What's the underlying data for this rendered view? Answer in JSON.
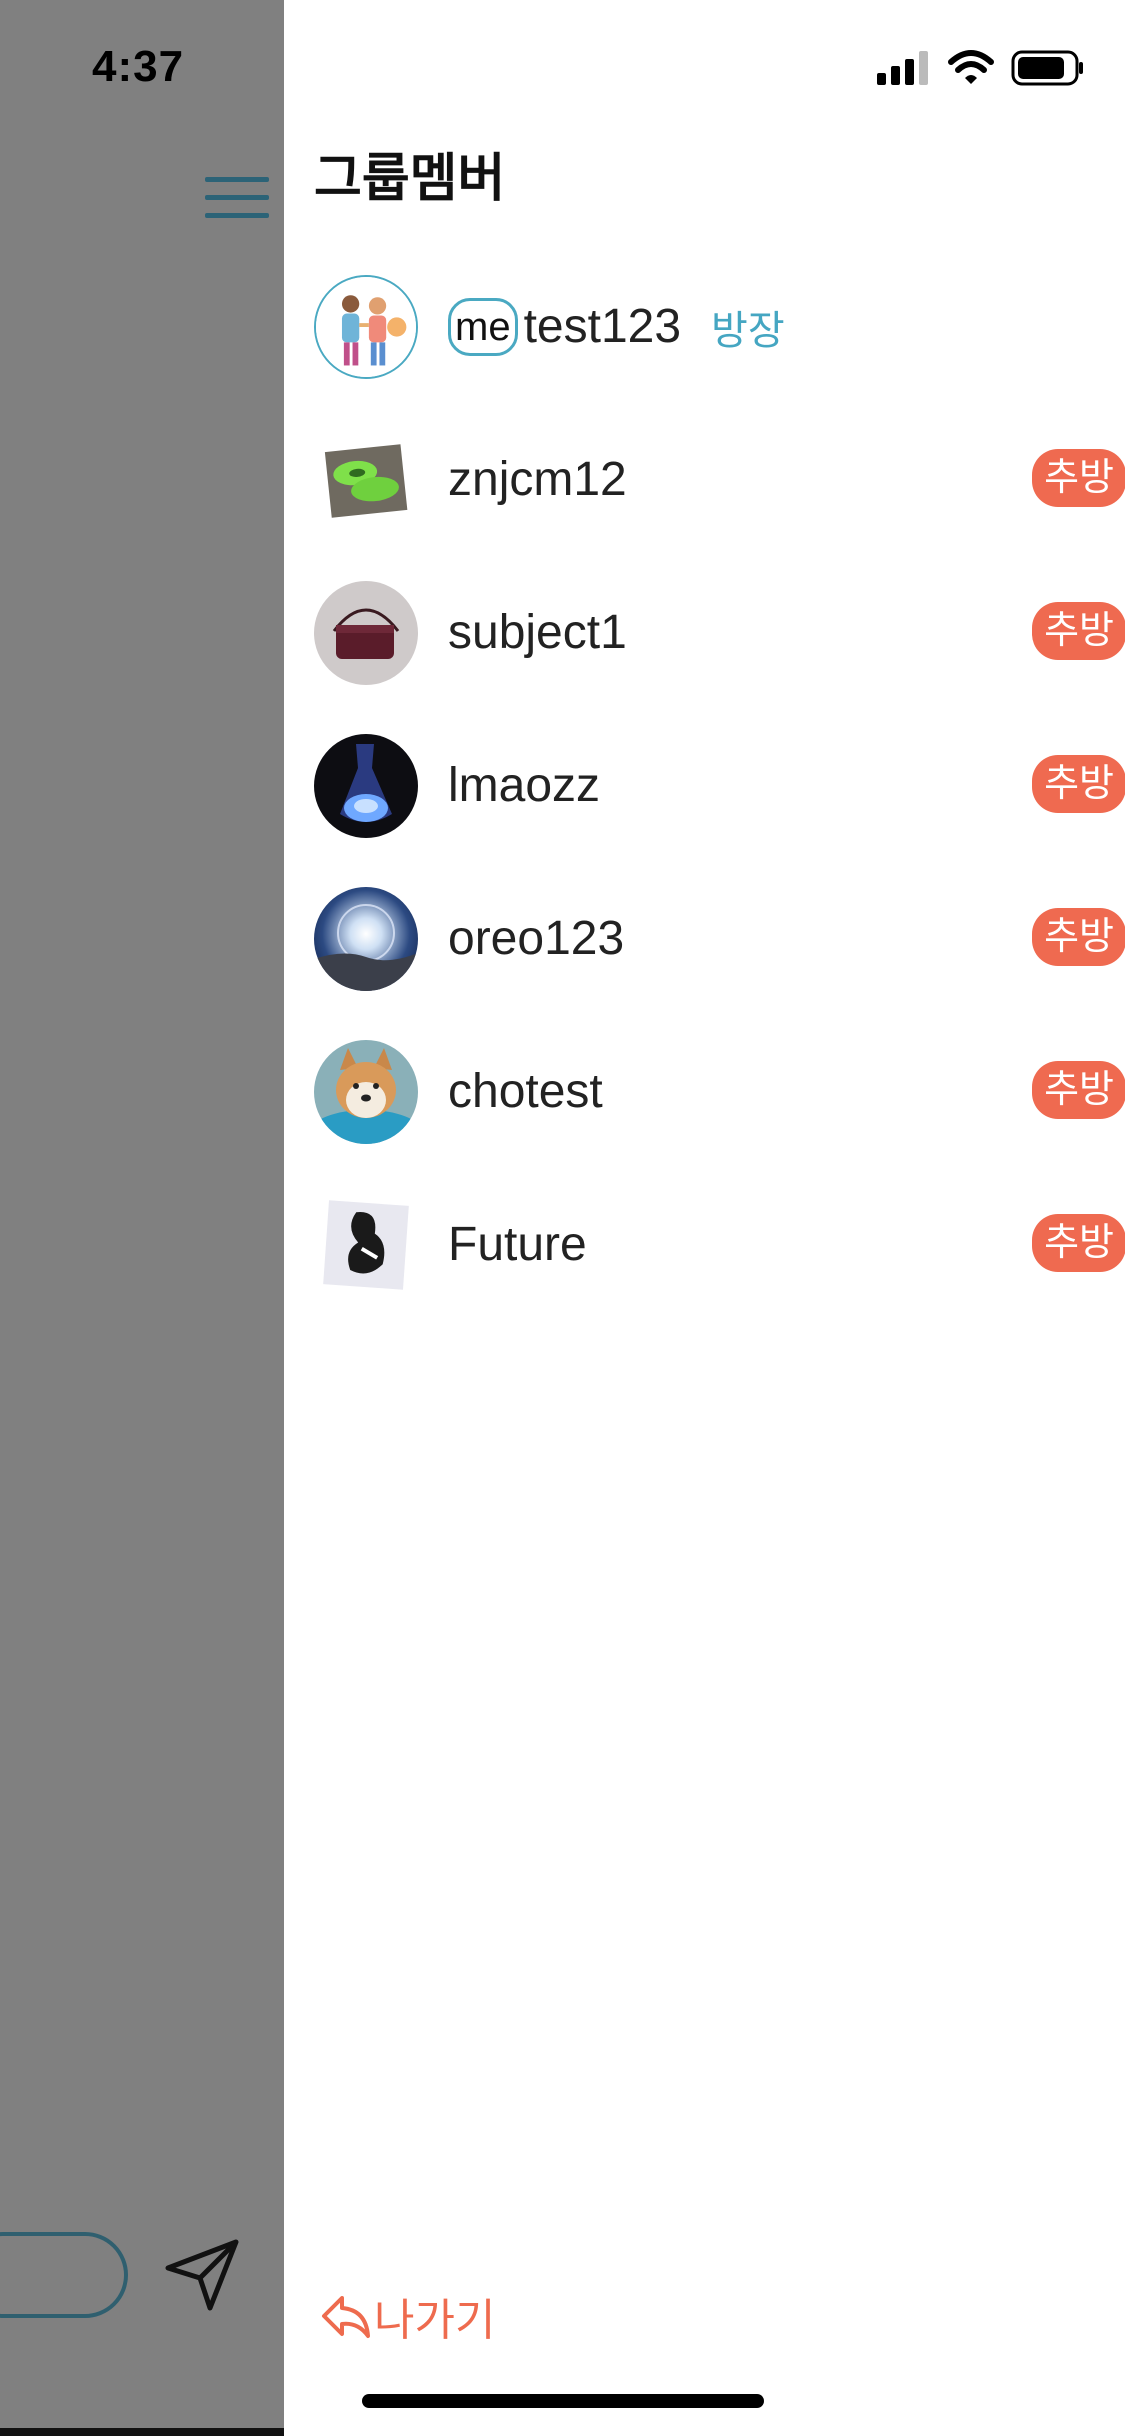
{
  "status_bar": {
    "time": "4:37",
    "icons": [
      "signal-icon",
      "wifi-icon",
      "battery-icon"
    ]
  },
  "background": {
    "menu_icon": "hamburger-menu-icon",
    "send_icon": "send-icon",
    "overlay_color": "#808080"
  },
  "drawer": {
    "title": "그룹멤버",
    "members": [
      {
        "name": "test123",
        "me_badge": "me",
        "role": "방장",
        "avatar": "couple-illustration-avatar"
      },
      {
        "name": "znjcm12",
        "action": "추방",
        "avatar": "green-shoes-photo"
      },
      {
        "name": "subject1",
        "action": "추방",
        "avatar": "bag-photo"
      },
      {
        "name": "lmaozz",
        "action": "추방",
        "avatar": "glowing-flask-photo"
      },
      {
        "name": "oreo123",
        "action": "추방",
        "avatar": "sun-halo-photo"
      },
      {
        "name": "chotest",
        "action": "추방",
        "avatar": "shiba-dog-photo"
      },
      {
        "name": "Future",
        "action": "추방",
        "avatar": "sneaker-photo"
      }
    ],
    "leave_label": "나가기"
  },
  "colors": {
    "accent": "#45a6c2",
    "kick": "#ef6a50",
    "leave": "#ee6b4e"
  }
}
